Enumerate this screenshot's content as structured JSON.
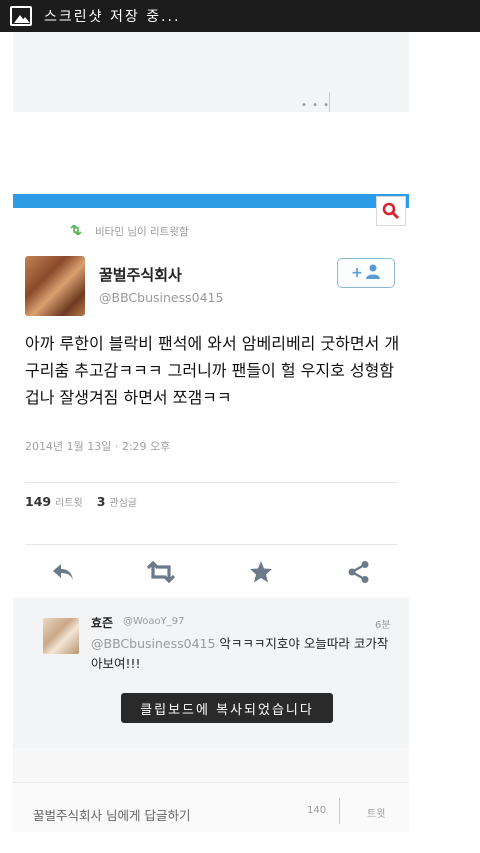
{
  "status_bar": {
    "text": "스크린샷 저장 중..."
  },
  "ghost": {
    "dots": "• • •"
  },
  "tweet": {
    "retweet_label": "비타민 님이 리트윗함",
    "name": "꿀벌주식회사",
    "handle": "@BBCbusiness0415",
    "text": "아까 루한이 블락비 팬석에 와서 암베리베리 굿하면서 개구리춤 추고감ㅋㅋㅋ 그러니까 팬들이 헐 우지호 성형함 겁나 잘생겨짐 하면서 쪼갬ㅋㅋ",
    "timestamp": "2014년 1월 13일 · 2:29 오후",
    "retweet_count": "149",
    "retweet_count_label": "리트윗",
    "favorite_count": "3",
    "favorite_count_label": "관심글"
  },
  "reply": {
    "name": "효즌",
    "handle": "@WoaoY_97",
    "time": "6분",
    "mention": "@BBCbusiness0415",
    "text": " 악ㅋㅋㅋ지호야 오늘따라 코가작아보여!!!"
  },
  "toast": {
    "text": "클립보드에 복사되었습니다"
  },
  "reply_bar": {
    "placeholder": "꿀벌주식회사 님에게 답글하기",
    "counter": "140",
    "send_label": "트윗"
  },
  "colors": {
    "accent_blue": "#2d9be6",
    "search_red": "#d9232e",
    "action_gray": "#6b7a8a",
    "retweet_green": "#5cb85c"
  }
}
